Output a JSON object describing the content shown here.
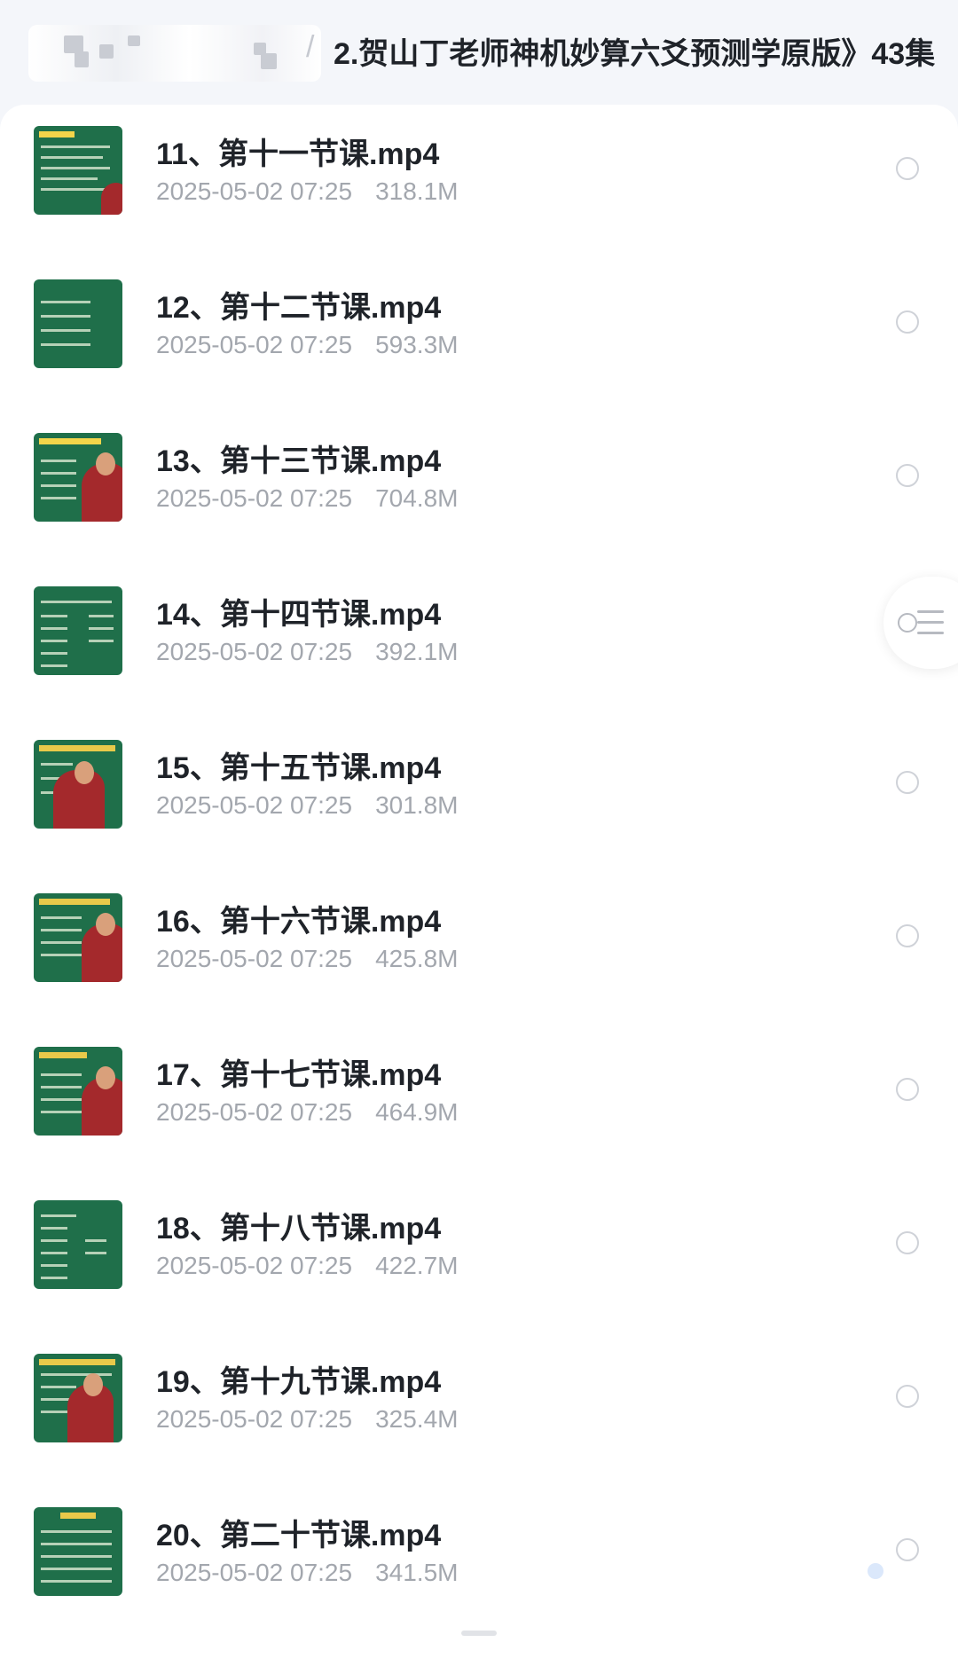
{
  "header": {
    "separator": "/",
    "current_folder": "2.贺山丁老师神机妙算六爻预测学原版》43集"
  },
  "files": [
    {
      "name": "11、第十一节课.mp4",
      "date": "2025-05-02 07:25",
      "size": "318.1M"
    },
    {
      "name": "12、第十二节课.mp4",
      "date": "2025-05-02 07:25",
      "size": "593.3M"
    },
    {
      "name": "13、第十三节课.mp4",
      "date": "2025-05-02 07:25",
      "size": "704.8M"
    },
    {
      "name": "14、第十四节课.mp4",
      "date": "2025-05-02 07:25",
      "size": "392.1M"
    },
    {
      "name": "15、第十五节课.mp4",
      "date": "2025-05-02 07:25",
      "size": "301.8M"
    },
    {
      "name": "16、第十六节课.mp4",
      "date": "2025-05-02 07:25",
      "size": "425.8M"
    },
    {
      "name": "17、第十七节课.mp4",
      "date": "2025-05-02 07:25",
      "size": "464.9M"
    },
    {
      "name": "18、第十八节课.mp4",
      "date": "2025-05-02 07:25",
      "size": "422.7M"
    },
    {
      "name": "19、第十九节课.mp4",
      "date": "2025-05-02 07:25",
      "size": "325.4M"
    },
    {
      "name": "20、第二十节课.mp4",
      "date": "2025-05-02 07:25",
      "size": "341.5M"
    }
  ],
  "icons": {
    "thumbnail": "video-thumbnail",
    "select": "radio-icon",
    "floating": "list-menu-icon"
  },
  "colors": {
    "title_text": "#1f2329",
    "meta_text": "#a3a7ae",
    "thumbnail_bg": "#1f6f4a",
    "page_bg": "#f4f6fa"
  }
}
